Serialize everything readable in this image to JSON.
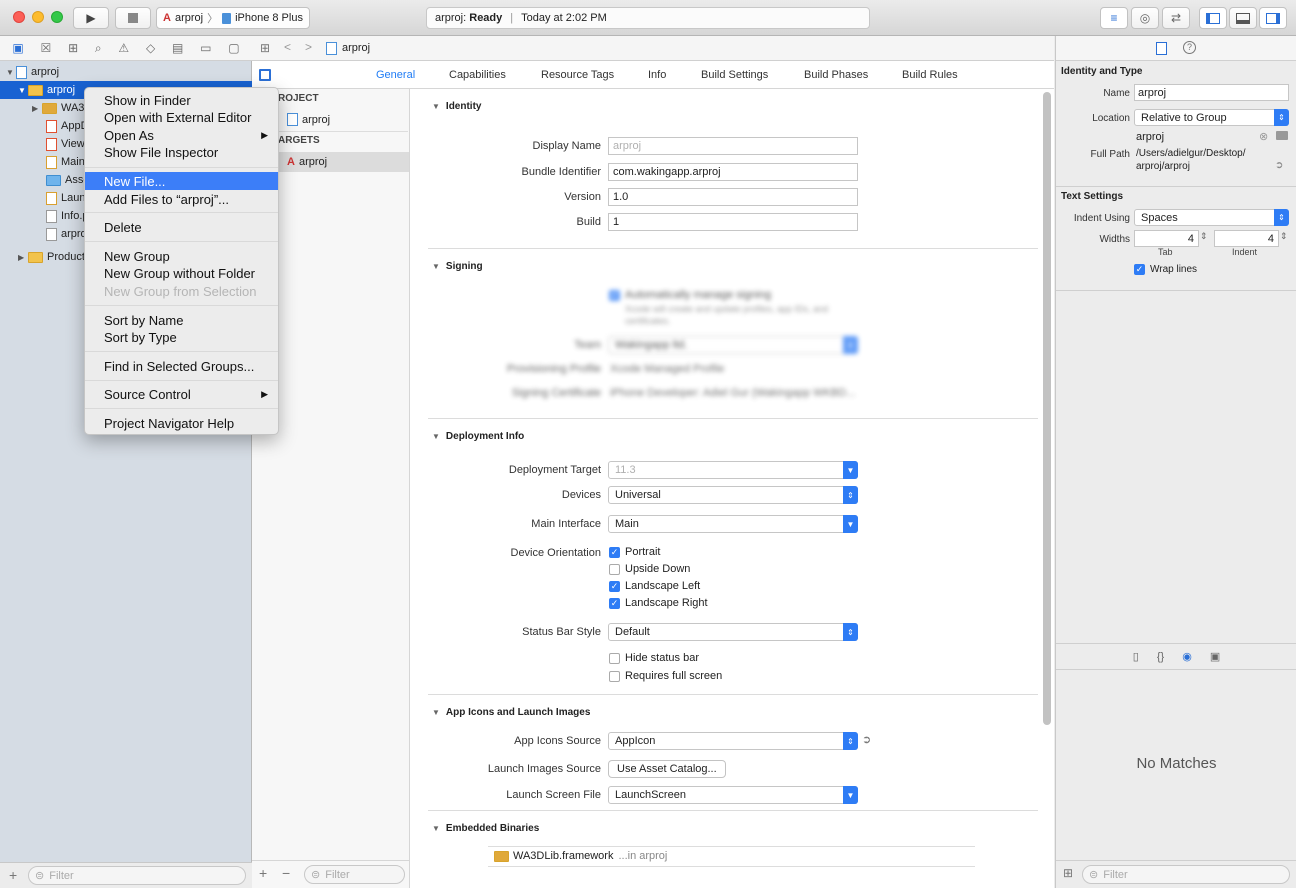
{
  "toolbar": {
    "scheme_target": "arproj",
    "scheme_device": "iPhone 8 Plus",
    "status_project": "arproj:",
    "status_state": "Ready",
    "status_time": "Today at 2:02 PM"
  },
  "navigator": {
    "rows": [
      {
        "label": "arproj"
      },
      {
        "label": "arproj"
      },
      {
        "label": "WA3"
      },
      {
        "label": "AppD"
      },
      {
        "label": "View"
      },
      {
        "label": "Main"
      },
      {
        "label": "Asse"
      },
      {
        "label": "Laun"
      },
      {
        "label": "Info.p"
      },
      {
        "label": "arpro"
      },
      {
        "label": "Product"
      }
    ],
    "filter_placeholder": "Filter"
  },
  "context_menu": {
    "items": [
      "Show in Finder",
      "Open with External Editor",
      "Open As",
      "Show File Inspector",
      "New File...",
      "Add Files to “arproj”...",
      "Delete",
      "New Group",
      "New Group without Folder",
      "New Group from Selection",
      "Sort by Name",
      "Sort by Type",
      "Find in Selected Groups...",
      "Source Control",
      "Project Navigator Help"
    ]
  },
  "editor": {
    "breadcrumb": "arproj",
    "tabs": [
      "General",
      "Capabilities",
      "Resource Tags",
      "Info",
      "Build Settings",
      "Build Phases",
      "Build Rules"
    ],
    "project_header": "ROJECT",
    "project_item": "arproj",
    "targets_header": "ARGETS",
    "target_item": "arproj",
    "filter_placeholder": "Filter",
    "identity": {
      "title": "Identity",
      "display_name_label": "Display Name",
      "display_name_value": "arproj",
      "bundle_label": "Bundle Identifier",
      "bundle_value": "com.wakingapp.arproj",
      "version_label": "Version",
      "version_value": "1.0",
      "build_label": "Build",
      "build_value": "1"
    },
    "signing": {
      "title": "Signing",
      "auto_label": "Automatically manage signing",
      "auto_desc": "Xcode will create and update profiles, app IDs, and certificates.",
      "team_label": "Team",
      "team_value": "Wakingapp ltd.",
      "profile_label": "Provisioning Profile",
      "profile_value": "Xcode Managed Profile",
      "cert_label": "Signing Certificate",
      "cert_value": "iPhone Developer: Adiel Gur (Wakingapp WKBD..."
    },
    "deployment": {
      "title": "Deployment Info",
      "target_label": "Deployment Target",
      "target_value": "11.3",
      "devices_label": "Devices",
      "devices_value": "Universal",
      "interface_label": "Main Interface",
      "interface_value": "Main",
      "orientation_label": "Device Orientation",
      "orientations": [
        {
          "label": "Portrait",
          "checked": true
        },
        {
          "label": "Upside Down",
          "checked": false
        },
        {
          "label": "Landscape Left",
          "checked": true
        },
        {
          "label": "Landscape Right",
          "checked": true
        }
      ],
      "statusbar_label": "Status Bar Style",
      "statusbar_value": "Default",
      "hide_status": "Hide status bar",
      "full_screen": "Requires full screen"
    },
    "icons": {
      "title": "App Icons and Launch Images",
      "source_label": "App Icons Source",
      "source_value": "AppIcon",
      "launch_label": "Launch Images Source",
      "launch_button": "Use Asset Catalog...",
      "screen_label": "Launch Screen File",
      "screen_value": "LaunchScreen"
    },
    "embedded": {
      "title": "Embedded Binaries",
      "framework": "WA3DLib.framework",
      "framework_loc": "...in arproj"
    }
  },
  "inspector": {
    "identity_title": "Identity and Type",
    "name_label": "Name",
    "name_value": "arproj",
    "location_label": "Location",
    "location_value": "Relative to Group",
    "location_path": "arproj",
    "fullpath_label": "Full Path",
    "fullpath_value1": "/Users/adielgur/Desktop/",
    "fullpath_value2": "arproj/arproj",
    "text_title": "Text Settings",
    "indent_label": "Indent Using",
    "indent_value": "Spaces",
    "widths_label": "Widths",
    "tab_value": "4",
    "indent_width_value": "4",
    "tab_label": "Tab",
    "indent_sub_label": "Indent",
    "wrap_label": "Wrap lines",
    "no_matches": "No Matches",
    "filter_placeholder": "Filter"
  }
}
